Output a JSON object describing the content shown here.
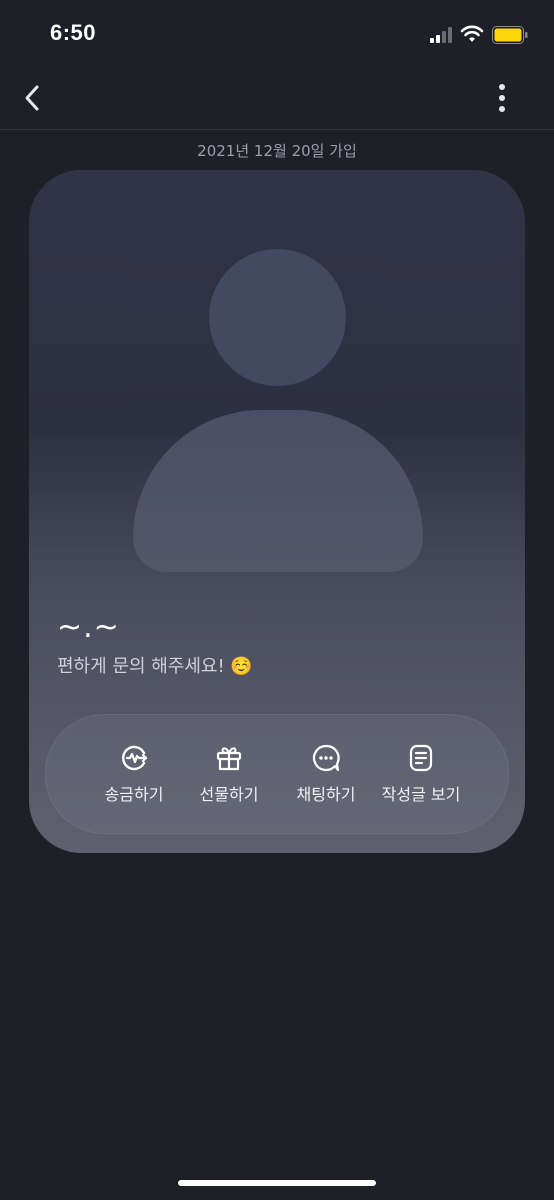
{
  "status_bar": {
    "time": "6:50",
    "icons": [
      "signal-icon",
      "wifi-icon",
      "battery-icon"
    ],
    "battery_color": "#ffd60a"
  },
  "nav": {
    "back_icon": "chevron-left-icon",
    "more_icon": "more-vertical-icon"
  },
  "join_date": "2021년 12월 20일 가입",
  "profile": {
    "nickname": "~.~",
    "status_message": "편하게 문의 해주세요! ☺️"
  },
  "actions": [
    {
      "label": "송금하기",
      "icon": "send-money-icon"
    },
    {
      "label": "선물하기",
      "icon": "gift-icon"
    },
    {
      "label": "채팅하기",
      "icon": "chat-icon"
    },
    {
      "label": "작성글 보기",
      "icon": "posts-icon"
    }
  ],
  "colors": {
    "background": "#1e1f27",
    "card_top": "#313447",
    "card_bottom": "#5f616e"
  }
}
